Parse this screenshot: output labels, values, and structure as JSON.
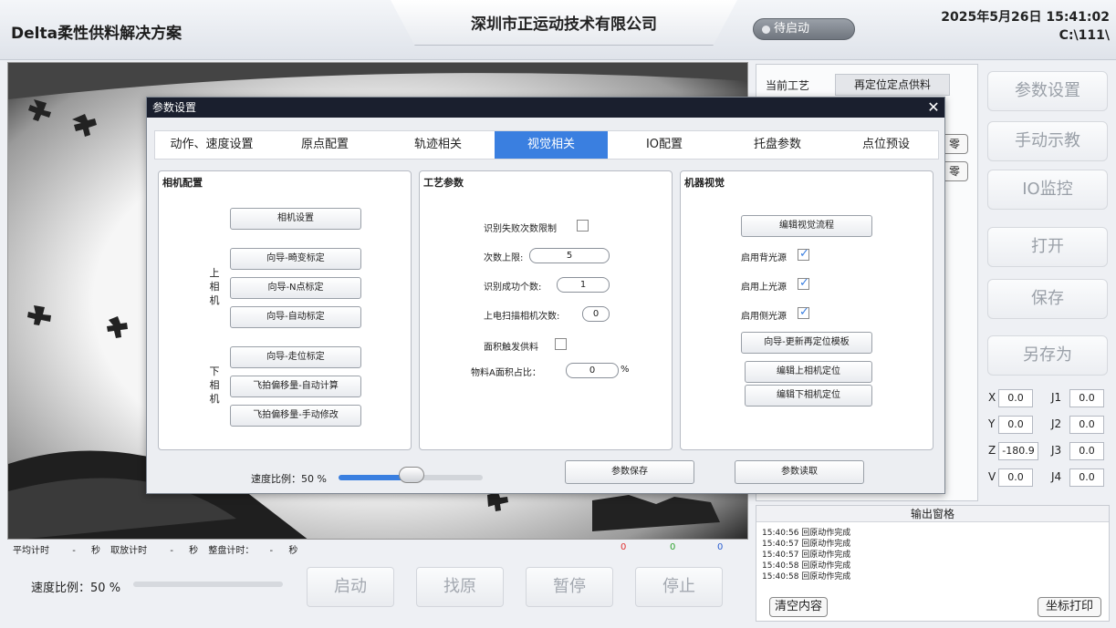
{
  "header": {
    "app_title": "Delta柔性供料解决方案",
    "company": "深圳市正运动技术有限公司",
    "status": "待启动",
    "datetime": "2025年5月26日  15:41:02",
    "path": "C:\\111\\"
  },
  "process": {
    "label": "当前工艺",
    "value": "再定位定点供料",
    "zero_a": "零",
    "zero_b": "零"
  },
  "side_buttons": [
    "参数设置",
    "手动示教",
    "IO监控",
    "打开",
    "保存",
    "另存为"
  ],
  "coords": {
    "X": "0.0",
    "Y": "0.0",
    "Z": "-180.9",
    "V": "0.0",
    "J1": "0.0",
    "J2": "0.0",
    "J3": "0.0",
    "J4": "0.0"
  },
  "output": {
    "title": "输出窗格",
    "lines": [
      "15:40:56  回原动作完成",
      "15:40:57  回原动作完成",
      "15:40:57  回原动作完成",
      "15:40:58  回原动作完成",
      "15:40:58  回原动作完成"
    ],
    "clear": "清空内容",
    "print": "坐标打印"
  },
  "timers": {
    "avg": "平均计时",
    "avg_val": "-",
    "unit1": "秒",
    "place": "取放计时",
    "place_val": "-",
    "unit2": "秒",
    "tray": "整盘计时：",
    "tray_val": "-",
    "unit3": "秒",
    "c_red": "0",
    "c_green": "0",
    "c_blue": "0"
  },
  "bottom": {
    "speed_label": "速度比例：",
    "speed_value": "50 %",
    "speed_ratio": 0.5,
    "buttons": [
      "启动",
      "找原",
      "暂停",
      "停止"
    ]
  },
  "dialog": {
    "title": "参数设置",
    "close": "✕",
    "tabs": [
      "动作、速度设置",
      "原点配置",
      "轨迹相关",
      "视觉相关",
      "IO配置",
      "托盘参数",
      "点位预设"
    ],
    "active_tab": 3,
    "camera_group": {
      "title": "相机配置",
      "camera_settings": "相机设置",
      "upper_label": [
        "上",
        "相",
        "机"
      ],
      "lower_label": [
        "下",
        "相",
        "机"
      ],
      "upper_buttons": [
        "向导-畸变标定",
        "向导-N点标定",
        "向导-自动标定"
      ],
      "lower_buttons": [
        "向导-走位标定",
        "飞拍偏移量-自动计算",
        "飞拍偏移量-手动修改"
      ]
    },
    "process_group": {
      "title": "工艺参数",
      "fail_limit": "识别失败次数限制",
      "max_times_label": "次数上限:",
      "max_times": "5",
      "success_count_label": "识别成功个数:",
      "success_count": "1",
      "scan_label": "上电扫描相机次数:",
      "scan_count": "0",
      "area_trigger": "面积触发供料",
      "area_ratio_label": "物料A面积占比：",
      "area_ratio": "0",
      "percent": "%"
    },
    "vision_group": {
      "title": "机器视觉",
      "edit_flow": "编辑视觉流程",
      "back_light": "启用背光源",
      "top_light": "启用上光源",
      "side_light": "启用侧光源",
      "update_template": "向导-更新再定位模板",
      "edit_upper": "编辑上相机定位",
      "edit_lower": "编辑下相机定位"
    },
    "speed_label": "速度比例：50 %",
    "speed_ratio": 0.5,
    "save": "参数保存",
    "load": "参数读取"
  }
}
